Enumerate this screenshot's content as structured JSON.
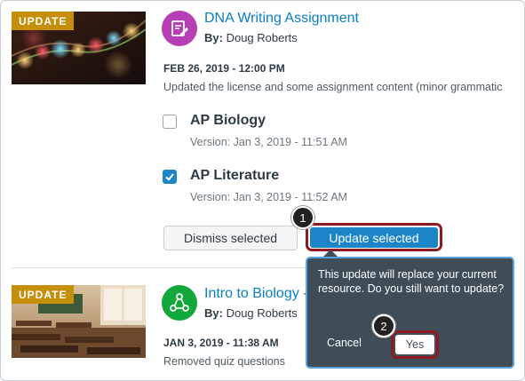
{
  "updates": [
    {
      "badge": "UPDATE",
      "title": "DNA Writing Assignment",
      "by_label": "By:",
      "author": "Doug Roberts",
      "date": "FEB 26, 2019 - 12:00 PM",
      "description": "Updated the license and some assignment content (minor grammatic",
      "courses": [
        {
          "name": "AP Biology",
          "version": "Version: Jan 3, 2019 - 11:51 AM",
          "checked": false
        },
        {
          "name": "AP Literature",
          "version": "Version: Jan 3, 2019 - 11:52 AM",
          "checked": true
        }
      ],
      "dismiss_label": "Dismiss selected",
      "update_label": "Update selected"
    },
    {
      "badge": "UPDATE",
      "title": "Intro to Biology -",
      "by_label": "By:",
      "author": "Doug Roberts",
      "date": "JAN 3, 2019 - 11:38 AM",
      "description": "Removed quiz questions"
    }
  ],
  "popover": {
    "message": "This update will replace your current resource. Do you still want to update?",
    "cancel_label": "Cancel",
    "yes_label": "Yes"
  },
  "steps": [
    "1",
    "2"
  ],
  "colors": {
    "link": "#0a7ec2",
    "primary_button": "#1b85c7",
    "badge": "#c78e0a",
    "highlight": "#8f1b22",
    "popover": "#3e4d57"
  }
}
